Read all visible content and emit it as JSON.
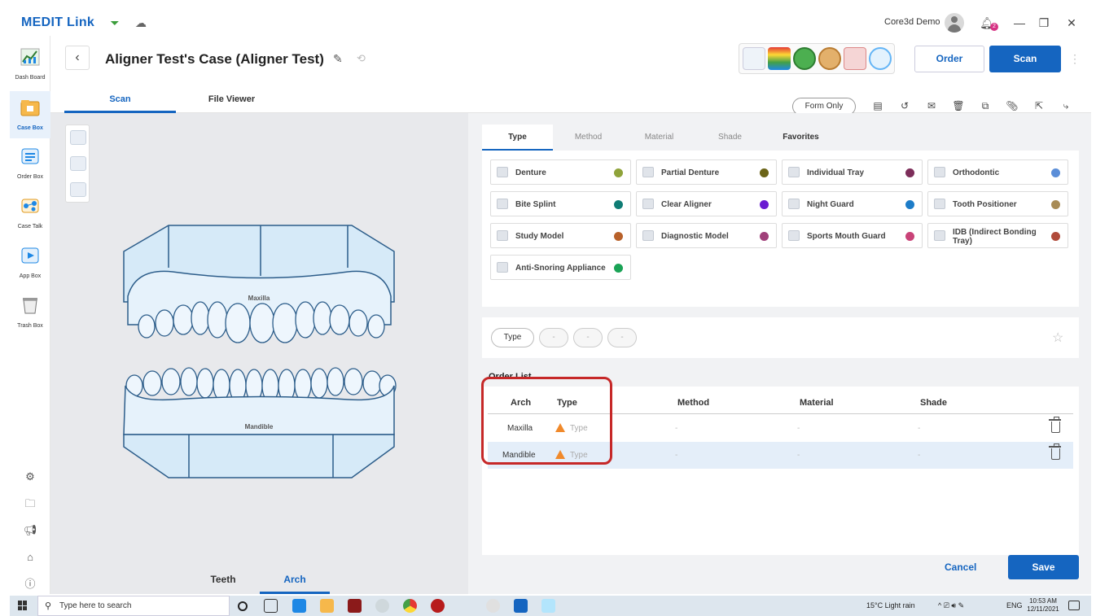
{
  "app": {
    "name": "MEDIT Link",
    "user": "Core3d Demo",
    "notification_count": "2"
  },
  "sidebar": {
    "items": [
      {
        "label": "Dash Board",
        "color": "#2e7d32"
      },
      {
        "label": "Case Box",
        "color": "#f0a830"
      },
      {
        "label": "Order Box",
        "color": "#1e88e5"
      },
      {
        "label": "Case Talk",
        "color": "#f0a830"
      },
      {
        "label": "App Box",
        "color": "#1e88e5"
      },
      {
        "label": "Trash Box",
        "color": "#888888"
      }
    ]
  },
  "header": {
    "title": "Aligner Test's Case (Aligner Test)",
    "order_label": "Order",
    "scan_label": "Scan",
    "tabs": [
      {
        "label": "Scan"
      },
      {
        "label": "File Viewer"
      }
    ],
    "form_only": "Form Only"
  },
  "viewer": {
    "maxilla_label": "Maxilla",
    "mandible_label": "Mandible",
    "bottom_tabs": [
      {
        "label": "Teeth"
      },
      {
        "label": "Arch"
      }
    ]
  },
  "type_panel": {
    "tabs": [
      {
        "label": "Type"
      },
      {
        "label": "Method"
      },
      {
        "label": "Material"
      },
      {
        "label": "Shade"
      },
      {
        "label": "Favorites"
      }
    ],
    "types": [
      {
        "label": "Denture",
        "color": "#8fa33a"
      },
      {
        "label": "Partial Denture",
        "color": "#6b6418"
      },
      {
        "label": "Individual Tray",
        "color": "#7d2e5a"
      },
      {
        "label": "Orthodontic",
        "color": "#5b8ed8"
      },
      {
        "label": "Bite Splint",
        "color": "#0f7c75"
      },
      {
        "label": "Clear Aligner",
        "color": "#6a1bd1"
      },
      {
        "label": "Night Guard",
        "color": "#1c7cc8"
      },
      {
        "label": "Tooth Positioner",
        "color": "#a88b55"
      },
      {
        "label": "Study Model",
        "color": "#b8612a"
      },
      {
        "label": "Diagnostic Model",
        "color": "#a0407a"
      },
      {
        "label": "Sports Mouth Guard",
        "color": "#c94378"
      },
      {
        "label": "IDB (Indirect Bonding Tray)",
        "color": "#b04a3a"
      },
      {
        "label": "Anti-Snoring Appliance",
        "color": "#1aa356"
      }
    ],
    "chips": [
      "Type",
      "-",
      "-",
      "-"
    ]
  },
  "order_list": {
    "title": "Order List",
    "headers": {
      "arch": "Arch",
      "type": "Type",
      "method": "Method",
      "material": "Material",
      "shade": "Shade"
    },
    "rows": [
      {
        "arch": "Maxilla",
        "type": "Type",
        "method": "-",
        "material": "-",
        "shade": "-"
      },
      {
        "arch": "Mandible",
        "type": "Type",
        "method": "-",
        "material": "-",
        "shade": "-"
      }
    ]
  },
  "footer": {
    "cancel": "Cancel",
    "save": "Save"
  },
  "taskbar": {
    "search_placeholder": "Type here to search",
    "weather": "15°C  Light rain",
    "lang": "ENG",
    "time": "10:53 AM",
    "date": "12/11/2021"
  }
}
